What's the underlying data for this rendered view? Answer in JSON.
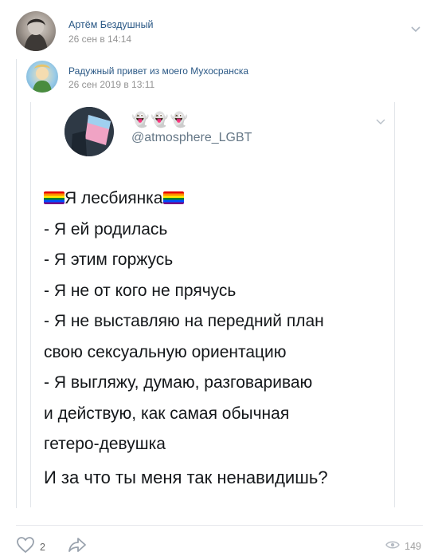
{
  "post": {
    "author": "Артём Бездушный",
    "date": "26 сен в 14:14",
    "avatar_icon": "user-avatar"
  },
  "repost": {
    "group_name": "Радужный привет из моего Мухосранска",
    "date": "26 сен 2019 в 13:11",
    "avatar_icon": "group-avatar"
  },
  "tweet": {
    "emojis": "👻👻👻",
    "handle": "@atmosphere_LGBT",
    "lines": [
      "Я лесбиянка",
      "- Я ей родилась",
      "- Я этим горжусь",
      "- Я не от кого не прячусь",
      "- Я не выставляю на передний план",
      "свою сексуальную ориентацию",
      "- Я выгляжу, думаю, разговариваю",
      "и действую, как самая обычная",
      "гетеро-девушка"
    ],
    "question": "И за что ты меня так ненавидишь?",
    "flag_icon": "rainbow-flag-icon"
  },
  "actions": {
    "likes": "2",
    "views": "149"
  },
  "colors": {
    "link": "#2a5885",
    "muted": "#939393",
    "handle": "#657786",
    "icon": "#99a2ad"
  }
}
